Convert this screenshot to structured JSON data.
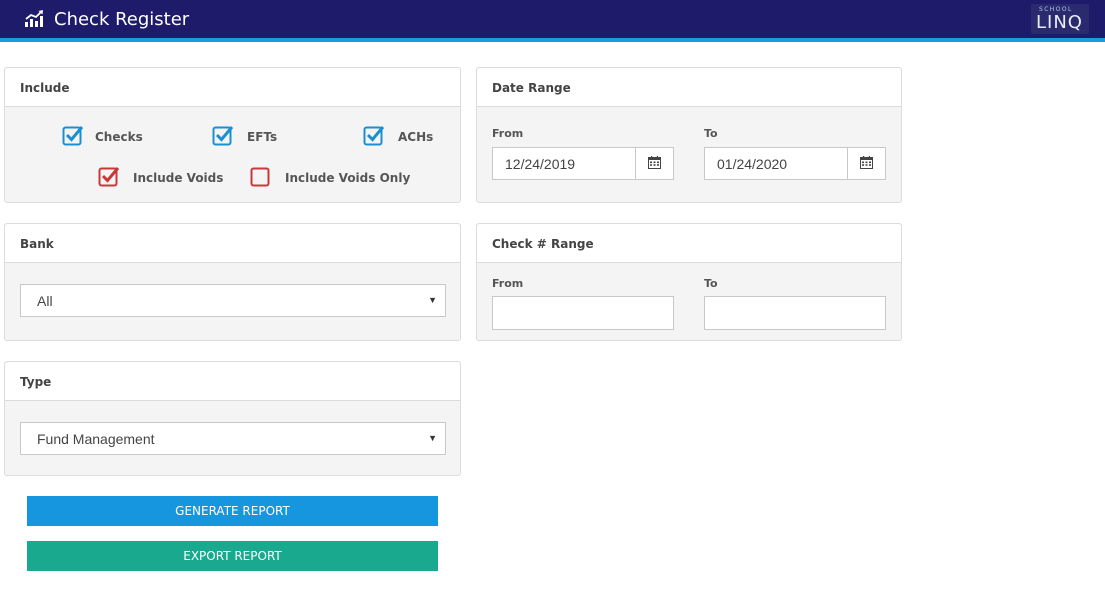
{
  "header": {
    "title": "Check Register",
    "brand_small": "SCHOOL",
    "brand_big": "LINQ",
    "app_icon": "chart-trend-icon"
  },
  "include": {
    "title": "Include",
    "checks": {
      "label": "Checks",
      "checked": true
    },
    "efts": {
      "label": "EFTs",
      "checked": true
    },
    "achs": {
      "label": "ACHs",
      "checked": true
    },
    "include_voids": {
      "label": "Include Voids",
      "checked": true
    },
    "include_voids_only": {
      "label": "Include Voids Only",
      "checked": false
    }
  },
  "date_range": {
    "title": "Date Range",
    "from_label": "From",
    "from_value": "12/24/2019",
    "to_label": "To",
    "to_value": "01/24/2020",
    "icon": "calendar-icon"
  },
  "bank": {
    "title": "Bank",
    "selected": "All"
  },
  "check_range": {
    "title": "Check # Range",
    "from_label": "From",
    "to_label": "To",
    "from_value": "",
    "to_value": ""
  },
  "type": {
    "title": "Type",
    "selected": "Fund Management"
  },
  "actions": {
    "generate_label": "GENERATE REPORT",
    "export_label": "EXPORT REPORT"
  },
  "colors": {
    "header_bg": "#1e1b6b",
    "header_accent": "#1a9de0",
    "checkbox_blue": "#1a8fd1",
    "checkbox_red": "#c8383a",
    "generate_bg": "#1596de",
    "export_bg": "#18a98f"
  }
}
